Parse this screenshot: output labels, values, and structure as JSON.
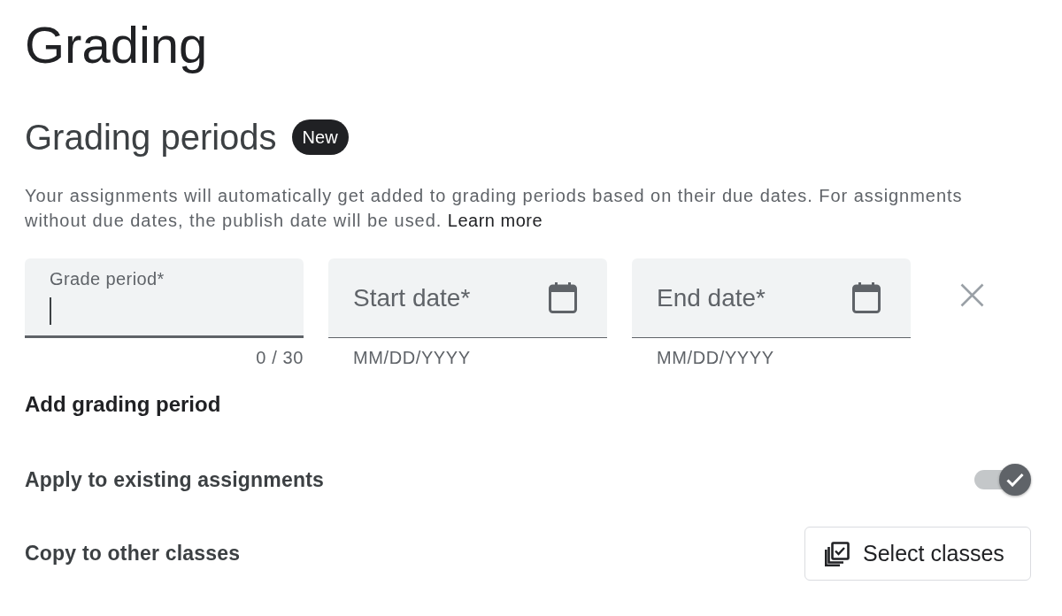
{
  "page": {
    "title": "Grading"
  },
  "grading_periods": {
    "heading": "Grading periods",
    "badge": "New",
    "description": "Your assignments will automatically get added to grading periods based on their due dates. For assignments without due dates, the publish date will be used.",
    "learn_more": "Learn more"
  },
  "period_fields": [
    {
      "kind": "text",
      "label": "Grade period*",
      "focused": true,
      "counter": "0 / 30"
    },
    {
      "kind": "date",
      "label": "Start date*",
      "focused": false,
      "helper": "MM/DD/YYYY"
    },
    {
      "kind": "date",
      "label": "End date*",
      "focused": false,
      "helper": "MM/DD/YYYY"
    }
  ],
  "add_grading_period": "Add grading period",
  "settings": [
    {
      "kind": "toggle",
      "label": "Apply to existing assignments",
      "on": true
    },
    {
      "kind": "button",
      "label": "Copy to other classes",
      "button_label": "Select classes"
    }
  ]
}
